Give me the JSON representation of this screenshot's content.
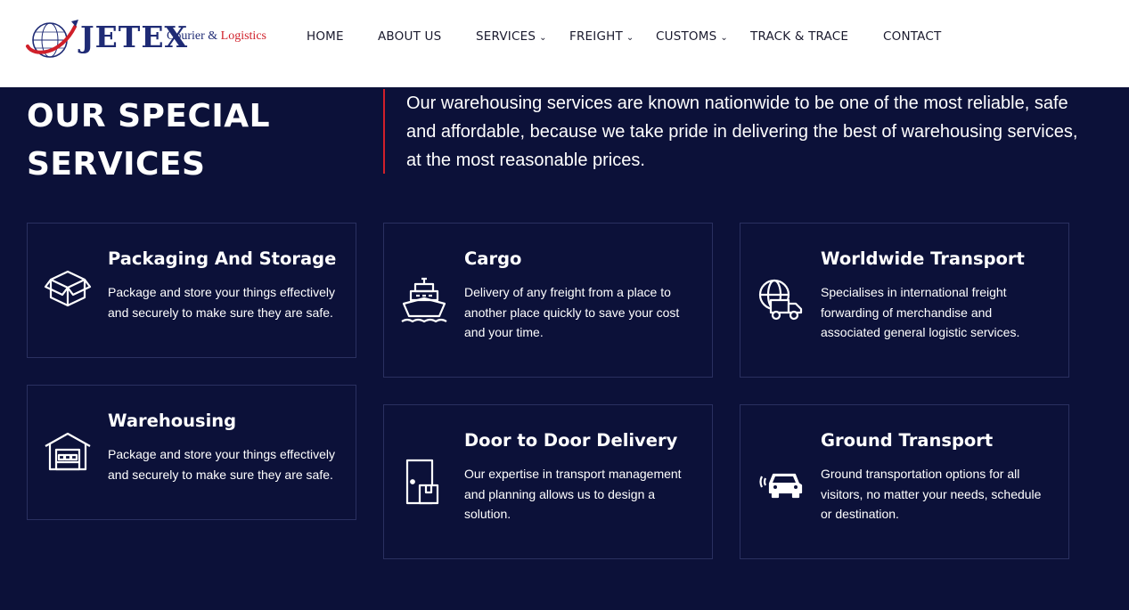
{
  "brand": {
    "name": "JETEX",
    "tagline_part1": "Courier",
    "tagline_amp": "&",
    "tagline_part2": "Logistics"
  },
  "nav": [
    {
      "label": "HOME",
      "dropdown": false
    },
    {
      "label": "ABOUT US",
      "dropdown": false
    },
    {
      "label": "SERVICES",
      "dropdown": true
    },
    {
      "label": "FREIGHT",
      "dropdown": true
    },
    {
      "label": "CUSTOMS",
      "dropdown": true
    },
    {
      "label": "TRACK & TRACE",
      "dropdown": false
    },
    {
      "label": "CONTACT",
      "dropdown": false
    }
  ],
  "hero": {
    "title_line1": "OUR SPECIAL",
    "title_line2": "SERVICES",
    "text": "Our warehousing services are known nationwide to be one of the most reliable, safe and affordable, because we take pride in delivering the best of warehousing services, at the most reasonable prices."
  },
  "services": [
    {
      "title": "Packaging And Storage",
      "desc": "Package and store your things effectively and securely to make sure they are safe.",
      "icon": "package-box-icon"
    },
    {
      "title": "Cargo",
      "desc": "Delivery of any freight from a place to another place quickly to save your cost and your time.",
      "icon": "ship-icon"
    },
    {
      "title": "Worldwide Transport",
      "desc": "Specialises in international freight forwarding of merchandise and associated general logistic services.",
      "icon": "globe-truck-icon"
    },
    {
      "title": "Warehousing",
      "desc": "Package and store your things effectively and securely to make sure they are safe.",
      "icon": "warehouse-icon"
    },
    {
      "title": "Door to Door Delivery",
      "desc": "Our expertise in transport management and planning allows us to design a solution.",
      "icon": "door-package-icon"
    },
    {
      "title": "Ground Transport",
      "desc": "Ground transportation options for all visitors, no matter your needs, schedule or destination.",
      "icon": "car-signal-icon"
    }
  ],
  "colors": {
    "background": "#0c1139",
    "accent": "#d0202a",
    "brand": "#1f2b75",
    "card_border": "#2a3060"
  }
}
